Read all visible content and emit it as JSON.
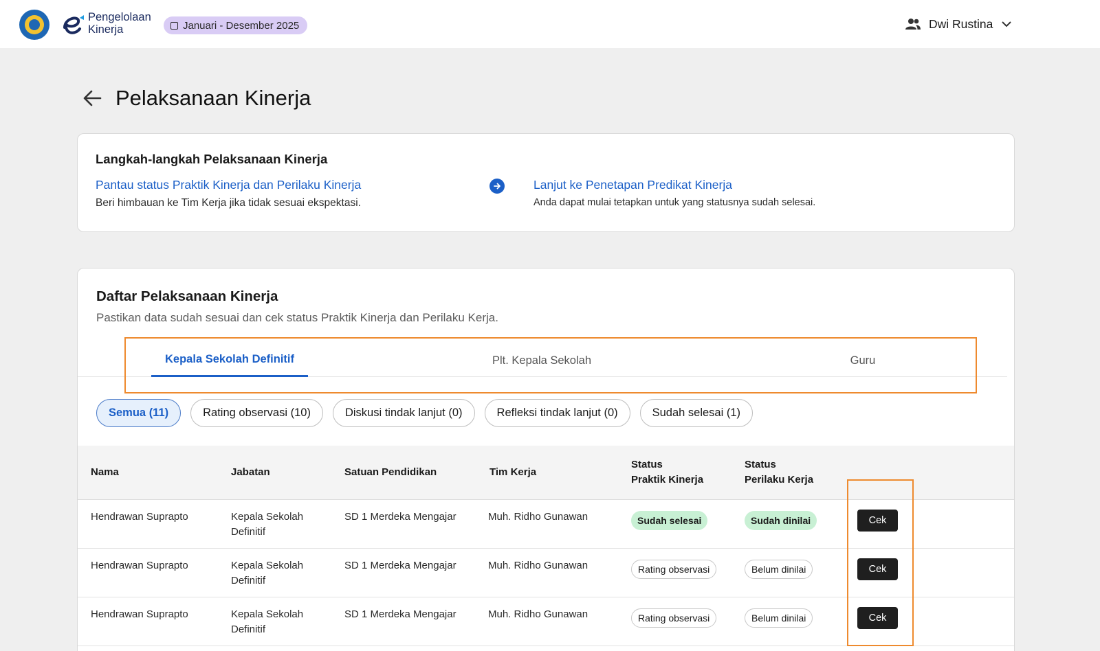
{
  "header": {
    "app_name_line1": "Pengelolaan",
    "app_name_line2": "Kinerja",
    "period": "Januari - Desember 2025",
    "user_name": "Dwi Rustina"
  },
  "page": {
    "title": "Pelaksanaan Kinerja"
  },
  "steps": {
    "title": "Langkah-langkah Pelaksanaan Kinerja",
    "step1_link": "Pantau status Praktik Kinerja dan Perilaku Kinerja",
    "step1_desc": "Beri himbauan ke Tim Kerja jika tidak sesuai ekspektasi.",
    "step2_link": "Lanjut ke Penetapan Predikat Kinerja",
    "step2_desc": "Anda dapat mulai tetapkan untuk yang statusnya sudah selesai."
  },
  "list": {
    "title": "Daftar Pelaksanaan Kinerja",
    "subtitle": "Pastikan data sudah sesuai dan cek status Praktik Kinerja dan Perilaku Kerja.",
    "tabs": [
      "Kepala Sekolah Definitif",
      "Plt. Kepala Sekolah",
      "Guru"
    ],
    "active_tab": "Kepala Sekolah Definitif",
    "filters": [
      "Semua (11)",
      "Rating observasi (10)",
      "Diskusi tindak lanjut (0)",
      "Refleksi tindak lanjut (0)",
      "Sudah selesai (1)"
    ],
    "active_filter": "Semua (11)"
  },
  "table": {
    "headers": {
      "nama": "Nama",
      "jabatan": "Jabatan",
      "satuan": "Satuan Pendidikan",
      "tim": "Tim Kerja",
      "praktik_1": "Status",
      "praktik_2": "Praktik Kinerja",
      "perilaku_1": "Status",
      "perilaku_2": "Perilaku Kerja"
    },
    "rows": [
      {
        "nama": "Hendrawan Suprapto",
        "jabatan_1": "Kepala Sekolah",
        "jabatan_2": "Definitif",
        "satuan": "SD 1 Merdeka Mengajar",
        "tim": "Muh. Ridho Gunawan",
        "praktik": "Sudah selesai",
        "perilaku": "Sudah dinilai",
        "action": "Cek"
      },
      {
        "nama": "Hendrawan Suprapto",
        "jabatan_1": "Kepala Sekolah",
        "jabatan_2": "Definitif",
        "satuan": "SD 1 Merdeka Mengajar",
        "tim": "Muh. Ridho Gunawan",
        "praktik": "Rating observasi",
        "perilaku": "Belum dinilai",
        "action": "Cek"
      },
      {
        "nama": "Hendrawan Suprapto",
        "jabatan_1": "Kepala Sekolah",
        "jabatan_2": "Definitif",
        "satuan": "SD 1 Merdeka Mengajar",
        "tim": "Muh. Ridho Gunawan",
        "praktik": "Rating observasi",
        "perilaku": "Belum dinilai",
        "action": "Cek"
      }
    ]
  },
  "colors": {
    "accent": "#1b5fc7",
    "highlight": "#ee8a2e",
    "done_badge": "#c8f0d4",
    "period_chip": "#d9ccf5"
  },
  "icons": {
    "logo": "tut-wuri-handayani-emblem",
    "back": "arrow-left-icon",
    "step_arrow": "arrow-right-circle-icon",
    "user": "people-icon",
    "user_menu": "chevron-down-icon",
    "period": "calendar-icon"
  }
}
